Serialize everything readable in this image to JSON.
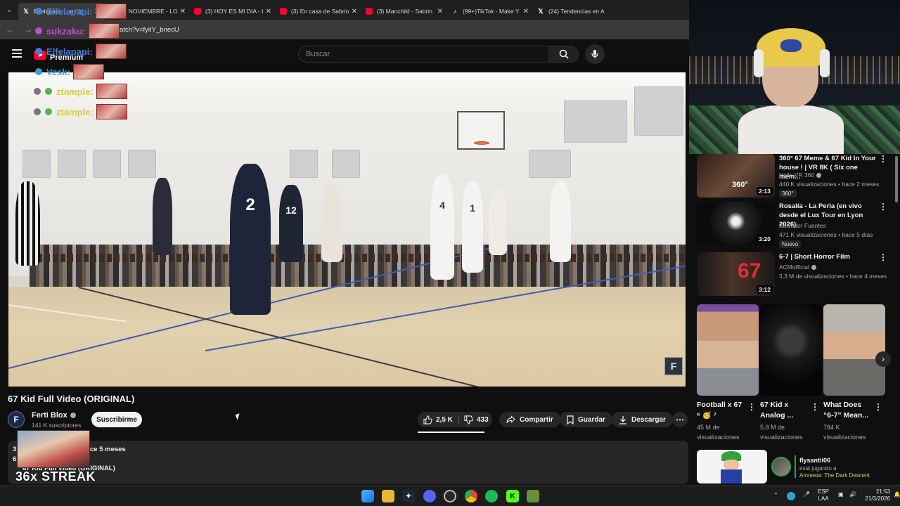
{
  "browser": {
    "tabs": [
      {
        "favicon": "x-icon",
        "title": "Elfelapapi: ... o / X",
        "active": true
      },
      {
        "favicon": "youtube-icon",
        "title": "(3) NOVIEMBRE - LOU"
      },
      {
        "favicon": "youtube-icon",
        "title": "(3) HOY ES MI DIA - I"
      },
      {
        "favicon": "youtube-icon",
        "title": "(3) En casa de Sabrina"
      },
      {
        "favicon": "youtube-icon",
        "title": "(3) Manchild - Sabrin"
      },
      {
        "favicon": "tiktok-icon",
        "title": "(99+)TikTok - Make Y"
      },
      {
        "favicon": "x-icon",
        "title": "(24) Tendencias en A"
      }
    ],
    "url": "atch?v=fyiIY_bnecU"
  },
  "youtube": {
    "logo_suffix": "Premium",
    "search_placeholder": "Buscar"
  },
  "chat_overlay": [
    {
      "user": "Elfelapapi:",
      "color": "#3d7fe0"
    },
    {
      "user": "sukzaku:",
      "color": "#c14bd6"
    },
    {
      "user": "Elfelapapi:",
      "color": "#3d7fe0"
    },
    {
      "user": "Vesk:",
      "color": "#2fa5d8"
    },
    {
      "user": "ztample:",
      "color": "#d9cd3c"
    },
    {
      "user": "ztample:",
      "color": "#d9cd3c"
    }
  ],
  "video": {
    "title": "67 Kid Full Video (ORIGINAL)",
    "channel": {
      "name": "Ferti Blox",
      "subscribers": "141 K suscriptores",
      "avatar_letter": "F"
    },
    "subscribe_label": "Suscribirme",
    "likes": "2,5 K",
    "dislikes": "433",
    "share_label": "Compartir",
    "save_label": "Guardar",
    "download_label": "Descargar",
    "more_label": "⋯",
    "description": {
      "line1_prefix": "3",
      "line1_suffix": "ce 5 meses",
      "line2": "6",
      "line3": "67 Kid Full Video (ORIGINAL)"
    },
    "jerseys": [
      "2",
      "12",
      "1",
      "4"
    ],
    "watermark_letter": "F"
  },
  "streak_overlay": "36x STREAK",
  "recommendations": [
    {
      "title_l1": "360° 67 Meme & 67 Kid In Your",
      "title_l2": "house ! | VR 8K ( Six one mem...",
      "channel": "Hello VR 360",
      "verified": true,
      "meta": "440 K visualizaciones • hace 2 meses",
      "badge": "360°",
      "duration": "2:13",
      "thumb_label": "360°"
    },
    {
      "title_l1": "Rosalía - La Perla (en vivo",
      "title_l2": "desde el Lux Tour en Lyon 2026)",
      "channel": "Salvador Fuentes",
      "verified": false,
      "meta": "471 K visualizaciones • hace 5 días",
      "badge": "Nuevo",
      "duration": "3:20"
    },
    {
      "title_l1": "6-7 | Short Horror Film",
      "title_l2": "",
      "channel": "ACMofficial",
      "verified": true,
      "meta": "3,3 M de visualizaciones • hace 4 meses",
      "badge": "",
      "duration": "3:12",
      "thumb_label": "67"
    }
  ],
  "shorts": [
    {
      "title_l1": "Football x 67",
      "title_l2": "⁶ 🥳 ⁷",
      "views_l1": "45 M de",
      "views_l2": "visualizaciones"
    },
    {
      "title_l1": "67 Kid x",
      "title_l2": "Analog ...",
      "views_l1": "5,8 M de",
      "views_l2": "visualizaciones"
    },
    {
      "title_l1": "What Does",
      "title_l2": "“6-7” Mean...",
      "views_l1": "784 K",
      "views_l2": "visualizaciones"
    }
  ],
  "live_card": {
    "name": "flysantii06",
    "status": "está jugando a",
    "game": "Amnesia: The Dark Descent"
  },
  "taskbar": {
    "lang_l1": "ESP",
    "lang_l2": "LAA",
    "time": "21:53",
    "date": "21/3/2026"
  },
  "colors": {
    "yt_red": "#ff0033",
    "background": "#0f0f0f",
    "surface": "#272727"
  }
}
